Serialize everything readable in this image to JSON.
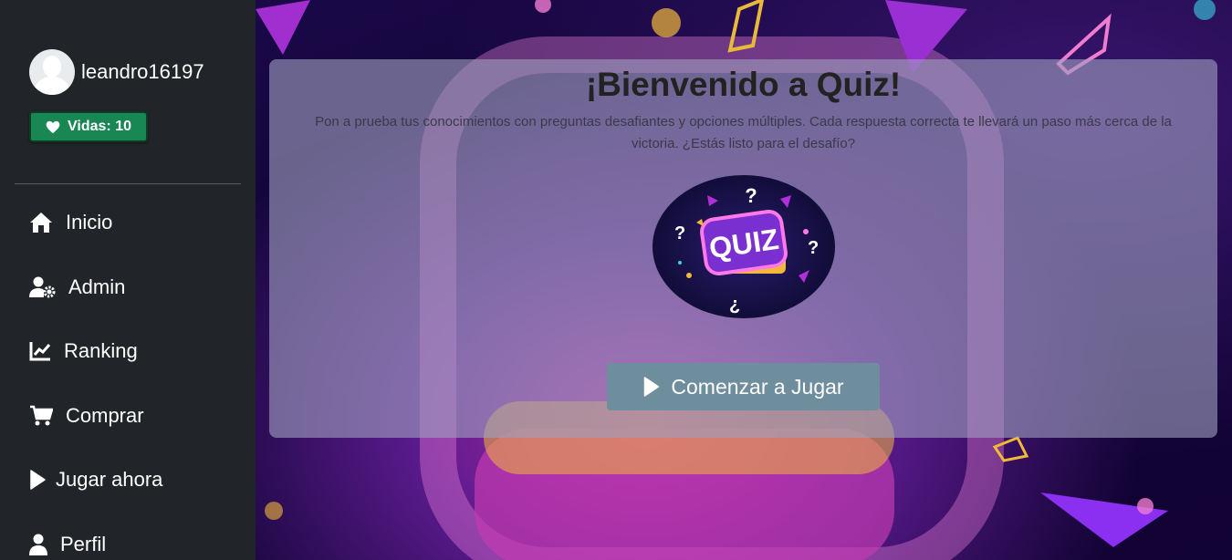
{
  "user": {
    "username": "leandro16197",
    "lives_label": "Vidas: 10",
    "lives": 10
  },
  "nav": {
    "items": [
      {
        "label": "Inicio",
        "icon": "home-icon"
      },
      {
        "label": "Admin",
        "icon": "user-gear-icon"
      },
      {
        "label": "Ranking",
        "icon": "chart-line-icon"
      },
      {
        "label": "Comprar",
        "icon": "cart-icon"
      },
      {
        "label": "Jugar ahora",
        "icon": "play-icon"
      },
      {
        "label": "Perfil",
        "icon": "user-icon"
      }
    ]
  },
  "welcome": {
    "title": "¡Bienvenido a Quiz!",
    "description": "Pon a prueba tus conocimientos con preguntas desafiantes y opciones múltiples. Cada respuesta correcta te llevará un paso más cerca de la victoria. ¿Estás listo para el desafío?",
    "logo_text": "QUIZ",
    "start_button": "Comenzar a Jugar"
  },
  "colors": {
    "sidebar": "#212529",
    "lives_badge": "#198754",
    "start_button": "#6e8e9d"
  }
}
